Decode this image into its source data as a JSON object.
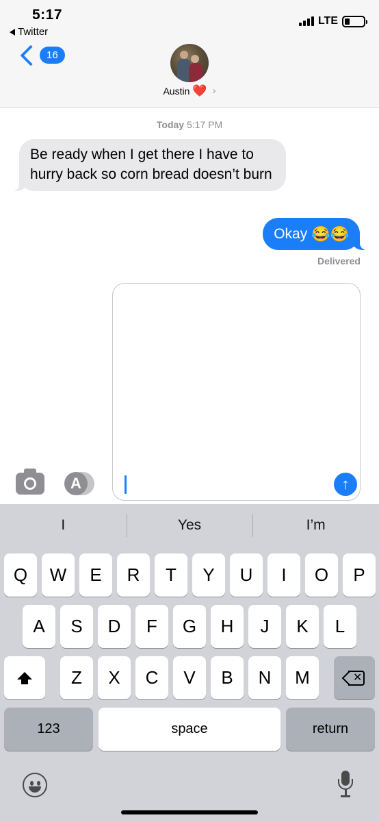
{
  "status": {
    "time": "5:17",
    "back_app": "Twitter",
    "network": "LTE"
  },
  "nav": {
    "unread_count": "16",
    "contact_name": "Austin",
    "contact_emoji": "❤️",
    "chevron": "›"
  },
  "messages": {
    "timestamp_day": "Today",
    "timestamp_time": "5:17 PM",
    "incoming_text": "Be ready when I get there I have to hurry back so corn bread doesn’t burn",
    "outgoing_text": "Okay",
    "outgoing_emoji": "😂😂",
    "delivery_status": "Delivered"
  },
  "input": {
    "value": ""
  },
  "keyboard": {
    "suggestions": [
      "I",
      "Yes",
      "I’m"
    ],
    "row1": [
      "Q",
      "W",
      "E",
      "R",
      "T",
      "Y",
      "U",
      "I",
      "O",
      "P"
    ],
    "row2": [
      "A",
      "S",
      "D",
      "F",
      "G",
      "H",
      "J",
      "K",
      "L"
    ],
    "row3": [
      "Z",
      "X",
      "C",
      "V",
      "B",
      "N",
      "M"
    ],
    "numbers_label": "123",
    "space_label": "space",
    "return_label": "return"
  },
  "colors": {
    "accent": "#1a7ef8",
    "incoming_bubble": "#e9e9eb",
    "keyboard_bg": "#d1d3d9"
  }
}
